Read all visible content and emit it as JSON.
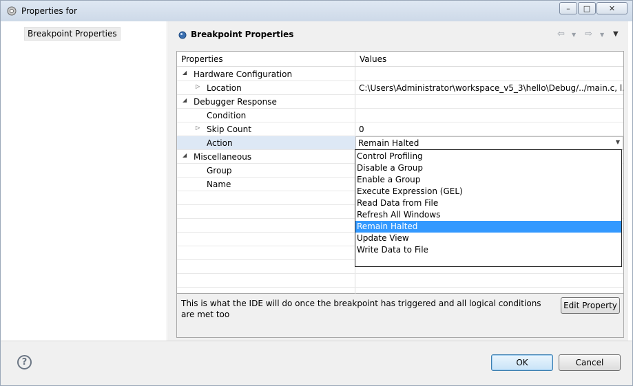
{
  "window": {
    "title": "Properties for",
    "icon": "gear-icon",
    "controls": {
      "minimize": "minimize-icon",
      "maximize": "maximize-icon",
      "close": "close-icon"
    }
  },
  "sidebar": {
    "items": [
      {
        "label": "Breakpoint Properties"
      }
    ]
  },
  "page": {
    "title": "Breakpoint Properties",
    "icon": "breakpoint-icon",
    "nav": {
      "back": "back-arrow-icon",
      "forward": "forward-arrow-icon",
      "menu": "view-menu-icon"
    }
  },
  "table": {
    "headers": {
      "properties": "Properties",
      "values": "Values"
    },
    "rows": [
      {
        "label": "Hardware Configuration",
        "value": "",
        "level": 0,
        "twisty": "expanded"
      },
      {
        "label": "Location",
        "value": "C:\\Users\\Administrator\\workspace_v5_3\\hello\\Debug/../main.c, l...",
        "level": 1,
        "twisty": "collapsed"
      },
      {
        "label": "Debugger Response",
        "value": "",
        "level": 0,
        "twisty": "expanded"
      },
      {
        "label": "Condition",
        "value": "",
        "level": 1,
        "twisty": "none"
      },
      {
        "label": "Skip Count",
        "value": "0",
        "level": 1,
        "twisty": "collapsed"
      },
      {
        "label": "Action",
        "value": "Remain Halted",
        "level": 1,
        "twisty": "none"
      },
      {
        "label": "Miscellaneous",
        "value": "",
        "level": 0,
        "twisty": "expanded"
      },
      {
        "label": "Group",
        "value": "",
        "level": 1,
        "twisty": "none"
      },
      {
        "label": "Name",
        "value": "",
        "level": 1,
        "twisty": "none"
      }
    ],
    "combo_value": "Remain Halted",
    "dropdown_options": [
      "Control Profiling",
      "Disable a Group",
      "Enable a Group",
      "Execute Expression (GEL)",
      "Read Data from File",
      "Refresh All Windows",
      "Remain Halted",
      "Update View",
      "Write Data to File"
    ],
    "selected_option": "Remain Halted"
  },
  "description": {
    "text": "This is what the IDE will do once the breakpoint has triggered and all logical conditions are met too",
    "edit_button": "Edit Property"
  },
  "footer": {
    "help": "?",
    "ok": "OK",
    "cancel": "Cancel"
  },
  "colors": {
    "selection": "#3399ff",
    "row_highlight": "#dde8f5",
    "ok_border": "#3c7fb1"
  }
}
